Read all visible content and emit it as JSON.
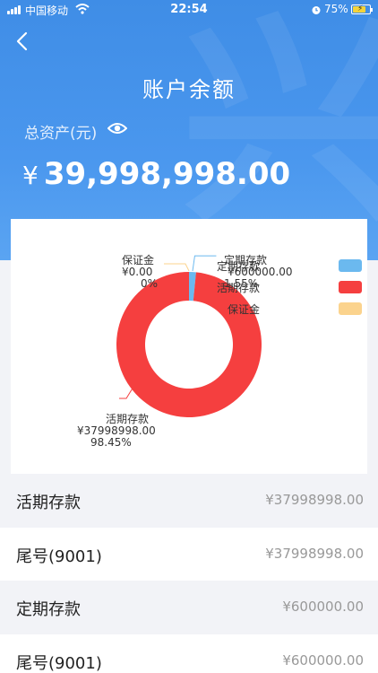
{
  "status_bar": {
    "carrier": "中国移动",
    "time": "22:54",
    "battery": "75%"
  },
  "header": {
    "title": "账户余额",
    "total_label": "总资产(元)",
    "amount": "39,998,998.00",
    "currency": "¥"
  },
  "chart_data": {
    "type": "pie",
    "variant": "donut",
    "series": [
      {
        "name": "定期存款",
        "value": 600000.0,
        "value_label": "¥600000.00",
        "percent_label": "1.55%",
        "color": "#6bb9ef"
      },
      {
        "name": "活期存款",
        "value": 37998998.0,
        "value_label": "¥37998998.00",
        "percent_label": "98.45%",
        "color": "#f53f3f"
      },
      {
        "name": "保证金",
        "value": 0.0,
        "value_label": "¥0.00",
        "percent_label": "0%",
        "color": "#fbd38d"
      }
    ],
    "legend_placement": "top-right"
  },
  "accounts": [
    {
      "name": "活期存款",
      "value": "¥37998998.00"
    },
    {
      "name": "尾号(9001)",
      "value": "¥37998998.00"
    },
    {
      "name": "定期存款",
      "value": "¥600000.00"
    },
    {
      "name": "尾号(9001)",
      "value": "¥600000.00"
    }
  ]
}
